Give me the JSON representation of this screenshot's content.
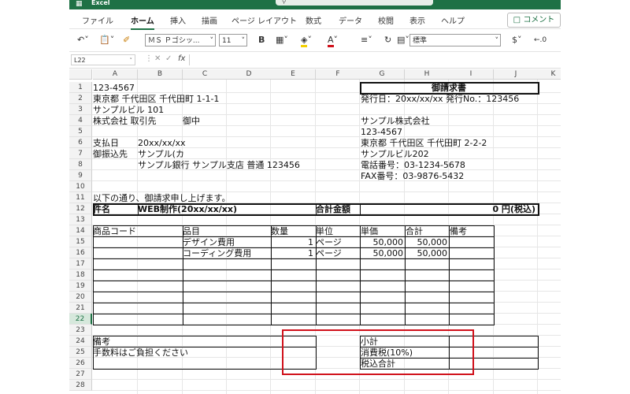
{
  "titlebar": {
    "app_name": "Excel"
  },
  "ribbon": {
    "tabs": [
      "ファイル",
      "ホーム",
      "挿入",
      "描画",
      "ページ レイアウト",
      "数式",
      "データ",
      "校閲",
      "表示",
      "ヘルプ"
    ],
    "active_tab": "ホーム",
    "comment_label": "コメント"
  },
  "toolbar": {
    "font_name": "ＭＳ Ｐゴシッ...",
    "font_size": "11",
    "bold": "B",
    "number_format": "標準",
    "currency": "$"
  },
  "formula_bar": {
    "name_box": "L22",
    "fx": "fx"
  },
  "columns": [
    "A",
    "B",
    "C",
    "D",
    "E",
    "F",
    "G",
    "H",
    "I",
    "J",
    "K"
  ],
  "rows": [
    "1",
    "2",
    "3",
    "4",
    "5",
    "6",
    "7",
    "8",
    "9",
    "10",
    "11",
    "12",
    "13",
    "14",
    "15",
    "16",
    "17",
    "18",
    "19",
    "20",
    "21",
    "22",
    "23",
    "24",
    "25",
    "26",
    "27",
    "28"
  ],
  "selected_row": "22",
  "sheet": {
    "a1": "123-4567",
    "a2": "東京都 千代田区 千代田町 1-1-1",
    "a3": "サンプルビル 101",
    "a4": "株式会社 取引先",
    "c4": "御中",
    "a6": "支払日",
    "b6": "20xx/xx/xx",
    "a7": "御振込先",
    "b7": "サンプル(カ",
    "b8": "サンプル銀行 サンプル支店 普通 123456",
    "g1": "御請求書",
    "g2": "発行日：20xx/xx/xx 発行No.：123456",
    "g4": "サンプル株式会社",
    "g5": "123-4567",
    "g6": "東京都 千代田区 千代田町 2-2-2",
    "g7": "サンプルビル202",
    "g8": "電話番号：03-1234-5678",
    "g9": "FAX番号：03-9876-5432",
    "a11": "以下の通り、御請求申し上げます。",
    "a12": "件名",
    "b12": "WEB制作(20xx/xx/xx)",
    "f12": "合計金額",
    "j12": "0 円(税込)",
    "a14": "商品コード",
    "c14": "品目",
    "e14": "数量",
    "f14": "単位",
    "g14": "単価",
    "h14": "合計",
    "i14": "備考",
    "c15": "デザイン費用",
    "e15": "1",
    "f15": "ページ",
    "g15": "50,000",
    "h15": "50,000",
    "c16": "コーディング費用",
    "e16": "1",
    "f16": "ページ",
    "g16": "50,000",
    "h16": "50,000",
    "a24": "備考",
    "a25": "手数料はご負担ください",
    "g24": "小計",
    "g25": "消費税(10%)",
    "g26": "税込合計"
  }
}
